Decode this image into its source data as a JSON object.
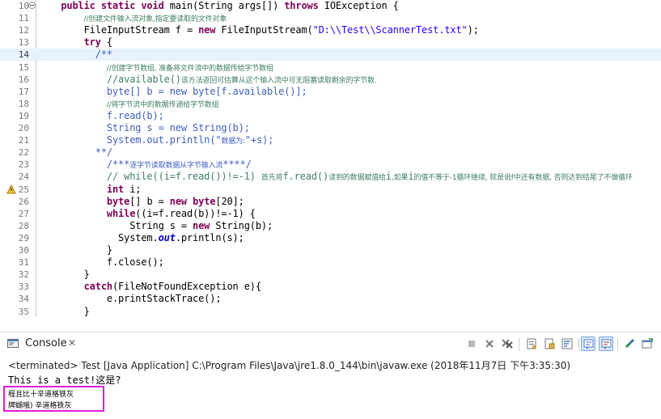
{
  "editor": {
    "lines": [
      {
        "n": "10",
        "tokens": [
          [
            "",
            "    "
          ],
          [
            "kw",
            "public static void"
          ],
          [
            "",
            " main(String args[]) "
          ],
          [
            "kw",
            "throws"
          ],
          [
            "",
            " IOException {"
          ]
        ],
        "fold": true
      },
      {
        "n": "11",
        "tokens": [
          [
            "",
            "        "
          ],
          [
            "cmt cmt-small",
            "//创建文件输入流对象,指定要读取的文件对象"
          ]
        ]
      },
      {
        "n": "12",
        "tokens": [
          [
            "",
            "        FileInputStream f = "
          ],
          [
            "kw",
            "new"
          ],
          [
            "",
            " FileInputStream("
          ],
          [
            "str",
            "\"D:\\\\Test\\\\ScannerTest.txt\""
          ],
          [
            "",
            ");"
          ]
        ]
      },
      {
        "n": "13",
        "tokens": [
          [
            "",
            "        "
          ],
          [
            "kw",
            "try"
          ],
          [
            "",
            " {"
          ]
        ]
      },
      {
        "n": "14",
        "tokens": [
          [
            "",
            "          "
          ],
          [
            "jd",
            "/**"
          ]
        ],
        "current": true
      },
      {
        "n": "15",
        "tokens": [
          [
            "",
            "            "
          ],
          [
            "cmt cmt-small",
            "//创建字节数组, 准备将文件流中的数据传给字节数组"
          ]
        ]
      },
      {
        "n": "16",
        "tokens": [
          [
            "",
            "            "
          ],
          [
            "cmt",
            "//available()"
          ],
          [
            "cmt cmt-small",
            "该方法返回可估算从这个输入流中可无阻塞读取剩余的字节数."
          ]
        ]
      },
      {
        "n": "17",
        "tokens": [
          [
            "",
            "            "
          ],
          [
            "jd",
            "byte[] b = new byte[f.available()];"
          ]
        ]
      },
      {
        "n": "18",
        "tokens": [
          [
            "",
            "            "
          ],
          [
            "cmt cmt-small",
            "//将字节流中的数据传递给字节数组"
          ]
        ]
      },
      {
        "n": "19",
        "tokens": [
          [
            "",
            "            "
          ],
          [
            "jd",
            "f.read(b);"
          ]
        ]
      },
      {
        "n": "20",
        "tokens": [
          [
            "",
            "            "
          ],
          [
            "jd",
            "String s = new String(b);"
          ]
        ]
      },
      {
        "n": "21",
        "tokens": [
          [
            "",
            "            "
          ],
          [
            "jd",
            "System.out.println(\""
          ],
          [
            "jd cmt-small",
            "数据为:"
          ],
          [
            "jd",
            "\"+s);"
          ]
        ]
      },
      {
        "n": "22",
        "tokens": [
          [
            "",
            "          "
          ],
          [
            "jd",
            "**/"
          ]
        ]
      },
      {
        "n": "23",
        "tokens": [
          [
            "",
            "            "
          ],
          [
            "jd",
            "/***"
          ],
          [
            "jd cmt-small",
            "逐字节读取数据从字节输入流"
          ],
          [
            "jd",
            "****/"
          ]
        ]
      },
      {
        "n": "24",
        "tokens": [
          [
            "",
            "            "
          ],
          [
            "cmt",
            "// while((i=f.read())!=-1) "
          ],
          [
            "cmt cmt-small",
            "首先将"
          ],
          [
            "cmt",
            "f.read()"
          ],
          [
            "cmt cmt-small",
            "读到的数据赋值给"
          ],
          [
            "cmt",
            "i"
          ],
          [
            "cmt cmt-small",
            ",如果"
          ],
          [
            "cmt",
            "i"
          ],
          [
            "cmt cmt-small",
            "的值不等于-1循环继续, 就是说f中还有数据, 否则达到结尾了不做循环"
          ]
        ]
      },
      {
        "n": "25",
        "tokens": [
          [
            "",
            "            "
          ],
          [
            "kw",
            "int"
          ],
          [
            "",
            " i;"
          ]
        ],
        "warn": true
      },
      {
        "n": "26",
        "tokens": [
          [
            "",
            "            "
          ],
          [
            "kw",
            "byte"
          ],
          [
            "",
            "[] b = "
          ],
          [
            "kw",
            "new"
          ],
          [
            "",
            " "
          ],
          [
            "kw",
            "byte"
          ],
          [
            "",
            "[20];"
          ]
        ]
      },
      {
        "n": "27",
        "tokens": [
          [
            "",
            "            "
          ],
          [
            "kw",
            "while"
          ],
          [
            "",
            "((i=f.read(b))!=-1) {"
          ]
        ]
      },
      {
        "n": "28",
        "tokens": [
          [
            "",
            "                String s = "
          ],
          [
            "kw",
            "new"
          ],
          [
            "",
            " String(b);"
          ]
        ]
      },
      {
        "n": "29",
        "tokens": [
          [
            "",
            "              System."
          ],
          [
            "sfield",
            "out"
          ],
          [
            "",
            ".println(s);"
          ]
        ]
      },
      {
        "n": "30",
        "tokens": [
          [
            "",
            "            }"
          ]
        ]
      },
      {
        "n": "31",
        "tokens": [
          [
            "",
            "            f.close();"
          ]
        ]
      },
      {
        "n": "32",
        "tokens": [
          [
            "",
            "        }"
          ]
        ]
      },
      {
        "n": "33",
        "tokens": [
          [
            "",
            "        "
          ],
          [
            "kw",
            "catch"
          ],
          [
            "",
            "(FileNotFoundException e){"
          ]
        ]
      },
      {
        "n": "34",
        "tokens": [
          [
            "",
            "            e.printStackTrace();"
          ]
        ]
      },
      {
        "n": "35",
        "tokens": [
          [
            "",
            "        }"
          ]
        ]
      }
    ]
  },
  "console": {
    "tab_label": "Console",
    "tab_close": "✕",
    "header": "<terminated> Test [Java Application] C:\\Program Files\\Java\\jre1.8.0_144\\bin\\javaw.exe (2018年11月7日 下午3:35:30)",
    "output": {
      "line1": "This is a test!这是?",
      "line2": "程且比十辛道格铁灰",
      "line3": "牌蝴哦) 辛道格铁灰"
    }
  },
  "toolbar": {
    "items": [
      "terminate-icon",
      "remove-launch-icon",
      "remove-all-icon",
      "scroll-lock-icon",
      "show-stdout-icon",
      "word-wrap-icon",
      "pin-console-icon",
      "display-selected-console-icon",
      "open-console-icon",
      "minimize-icon",
      "maximize-icon"
    ]
  },
  "colors": {
    "keyword": "#7f0055",
    "string": "#2a00ff",
    "comment": "#3f7f5f",
    "javadoc": "#3f5fbf",
    "current_line": "#e8f2fe",
    "highlight_box": "#e020d8"
  }
}
